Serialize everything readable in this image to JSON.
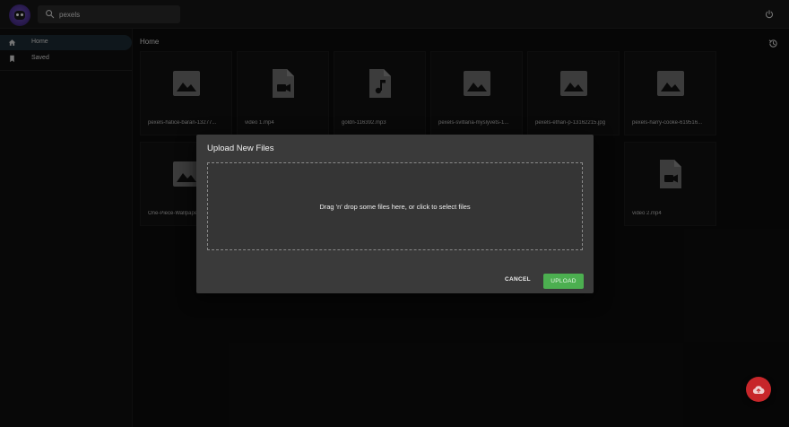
{
  "search": {
    "value": "pexels"
  },
  "sidebar": {
    "items": [
      {
        "label": "Home",
        "icon": "home-icon",
        "active": true
      },
      {
        "label": "Saved",
        "icon": "bookmark-icon",
        "active": false
      }
    ]
  },
  "breadcrumb": {
    "current": "Home"
  },
  "files": [
    {
      "name": "pexels-hatice-baran-13277...",
      "icon": "image-icon"
    },
    {
      "name": "video 1.mp4",
      "icon": "video-file-icon"
    },
    {
      "name": "goldn-116392.mp3",
      "icon": "audio-file-icon"
    },
    {
      "name": "pexels-svitlana-myslyvets-1...",
      "icon": "image-icon"
    },
    {
      "name": "pexels-ethan-p-13162215.jpg",
      "icon": "image-icon"
    },
    {
      "name": "pexels-harry-cooke-619516...",
      "icon": "image-icon"
    },
    {
      "name": "One-Piece-Wallpaper",
      "icon": "image-icon"
    },
    {
      "name": "video 2.mp4",
      "icon": "video-file-icon"
    }
  ],
  "modal": {
    "title": "Upload New Files",
    "dropzone_text": "Drag 'n' drop some files here, or click to select files",
    "cancel_label": "CANCEL",
    "upload_label": "UPLOAD"
  },
  "colors": {
    "upload_button": "#4caf50",
    "fab": "#c7262a",
    "active_nav": "#1d2a33"
  }
}
